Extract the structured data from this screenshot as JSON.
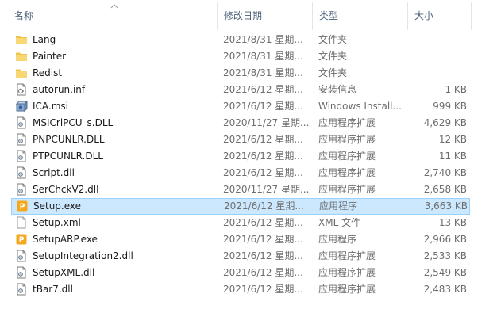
{
  "header": {
    "name": "名称",
    "date": "修改日期",
    "type": "类型",
    "size": "大小"
  },
  "colors": {
    "selected_bg": "#cce8ff",
    "selected_border": "#99d1ff",
    "folder": "#f8d775",
    "header_text": "#4c607a"
  },
  "rows": [
    {
      "name": "Lang",
      "date": "2021/8/31 星期...",
      "type": "文件夹",
      "size": "",
      "icon": "folder-icon",
      "selected": false
    },
    {
      "name": "Painter",
      "date": "2021/8/31 星期...",
      "type": "文件夹",
      "size": "",
      "icon": "folder-icon",
      "selected": false
    },
    {
      "name": "Redist",
      "date": "2021/8/31 星期...",
      "type": "文件夹",
      "size": "",
      "icon": "folder-icon",
      "selected": false
    },
    {
      "name": "autorun.inf",
      "date": "2021/6/12 星期...",
      "type": "安装信息",
      "size": "1 KB",
      "icon": "setup-info-icon",
      "selected": false
    },
    {
      "name": "ICA.msi",
      "date": "2021/6/12 星期...",
      "type": "Windows Install...",
      "size": "999 KB",
      "icon": "msi-package-icon",
      "selected": false
    },
    {
      "name": "MSICrlPCU_s.DLL",
      "date": "2020/11/27 星期...",
      "type": "应用程序扩展",
      "size": "4,629 KB",
      "icon": "dll-file-icon",
      "selected": false
    },
    {
      "name": "PNPCUNLR.DLL",
      "date": "2021/6/12 星期...",
      "type": "应用程序扩展",
      "size": "12 KB",
      "icon": "dll-file-icon",
      "selected": false
    },
    {
      "name": "PTPCUNLR.DLL",
      "date": "2021/6/12 星期...",
      "type": "应用程序扩展",
      "size": "11 KB",
      "icon": "dll-file-icon",
      "selected": false
    },
    {
      "name": "Script.dll",
      "date": "2021/6/12 星期...",
      "type": "应用程序扩展",
      "size": "2,740 KB",
      "icon": "dll-file-icon",
      "selected": false
    },
    {
      "name": "SerChckV2.dll",
      "date": "2020/11/27 星期...",
      "type": "应用程序扩展",
      "size": "2,658 KB",
      "icon": "dll-file-icon",
      "selected": false
    },
    {
      "name": "Setup.exe",
      "date": "2021/6/12 星期...",
      "type": "应用程序",
      "size": "3,663 KB",
      "icon": "painter-app-icon",
      "selected": true
    },
    {
      "name": "Setup.xml",
      "date": "2021/6/12 星期...",
      "type": "XML 文件",
      "size": "13 KB",
      "icon": "xml-file-icon",
      "selected": false
    },
    {
      "name": "SetupARP.exe",
      "date": "2021/6/12 星期...",
      "type": "应用程序",
      "size": "2,966 KB",
      "icon": "painter-app-icon",
      "selected": false
    },
    {
      "name": "SetupIntegration2.dll",
      "date": "2021/6/12 星期...",
      "type": "应用程序扩展",
      "size": "2,533 KB",
      "icon": "dll-file-icon",
      "selected": false
    },
    {
      "name": "SetupXML.dll",
      "date": "2021/6/12 星期...",
      "type": "应用程序扩展",
      "size": "2,549 KB",
      "icon": "dll-file-icon",
      "selected": false
    },
    {
      "name": "tBar7.dll",
      "date": "2021/6/12 星期...",
      "type": "应用程序扩展",
      "size": "2,483 KB",
      "icon": "dll-file-icon",
      "selected": false
    }
  ]
}
